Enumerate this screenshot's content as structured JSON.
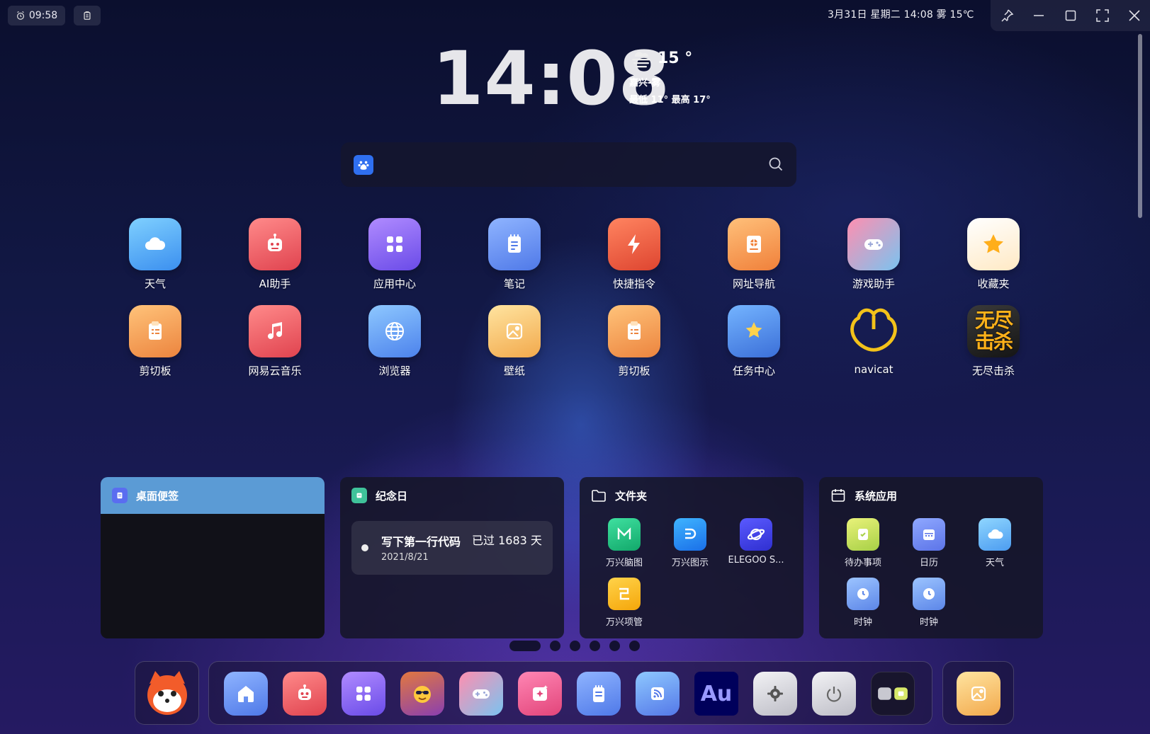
{
  "top_left": {
    "alarm_time": "09:58"
  },
  "status_bar": {
    "text": "3月31日 星期二 14:08 雾 15℃"
  },
  "clock": {
    "time": "14:08"
  },
  "weather": {
    "temperature": "15 °",
    "location": "嘉兴-雾",
    "range": "最低 11° 最高 17°"
  },
  "search": {
    "placeholder": ""
  },
  "apps": [
    {
      "label": "天气",
      "icon": "cloud-icon"
    },
    {
      "label": "AI助手",
      "icon": "robot-icon"
    },
    {
      "label": "应用中心",
      "icon": "grid-icon"
    },
    {
      "label": "笔记",
      "icon": "note-icon"
    },
    {
      "label": "快捷指令",
      "icon": "lightning-icon"
    },
    {
      "label": "网址导航",
      "icon": "compass-icon"
    },
    {
      "label": "游戏助手",
      "icon": "gamepad-icon"
    },
    {
      "label": "收藏夹",
      "icon": "star-icon"
    },
    {
      "label": "剪切板",
      "icon": "clipboard-icon"
    },
    {
      "label": "网易云音乐",
      "icon": "music-icon"
    },
    {
      "label": "浏览器",
      "icon": "globe-icon"
    },
    {
      "label": "壁纸",
      "icon": "picture-icon"
    },
    {
      "label": "剪切板",
      "icon": "clipboard-icon"
    },
    {
      "label": "任务中心",
      "icon": "sun-icon"
    },
    {
      "label": "navicat",
      "icon": "navicat-icon"
    },
    {
      "label": "无尽击杀",
      "icon": "game-logo-icon",
      "logo_text": "无尽击杀"
    }
  ],
  "widgets": {
    "note": {
      "title": "桌面便签"
    },
    "anniversary": {
      "title": "纪念日",
      "event": "写下第一行代码",
      "date": "2021/8/21",
      "days": "已过 1683 天"
    },
    "folder": {
      "title": "文件夹",
      "items": [
        {
          "label": "万兴脑图",
          "icon": "mindmap-icon"
        },
        {
          "label": "万兴图示",
          "icon": "diagram-icon"
        },
        {
          "label": "ELEGOO S...",
          "icon": "planet-icon"
        },
        {
          "label": "万兴项管",
          "icon": "project-icon"
        }
      ]
    },
    "system_apps": {
      "title": "系统应用",
      "items": [
        {
          "label": "待办事项",
          "icon": "todo-icon"
        },
        {
          "label": "日历",
          "icon": "calendar-icon"
        },
        {
          "label": "天气",
          "icon": "cloud-icon"
        },
        {
          "label": "时钟",
          "icon": "clock-icon"
        },
        {
          "label": "时钟",
          "icon": "clock-icon"
        }
      ]
    }
  },
  "pager": {
    "count": 6,
    "active": 0
  },
  "dock": {
    "avatar_icon": "fox-avatar-icon",
    "items": [
      {
        "icon": "home-icon"
      },
      {
        "icon": "robot-icon"
      },
      {
        "icon": "grid-icon"
      },
      {
        "icon": "emoji-sunglasses-icon"
      },
      {
        "icon": "gamepad-icon"
      },
      {
        "icon": "ai-sparkle-icon"
      },
      {
        "icon": "note-icon"
      },
      {
        "icon": "rss-icon"
      },
      {
        "icon": "audition-icon",
        "text": "Au"
      },
      {
        "icon": "gear-icon"
      },
      {
        "icon": "power-icon"
      },
      {
        "icon": "widget-toggle-icon"
      }
    ],
    "right_icon": "picture-icon"
  }
}
